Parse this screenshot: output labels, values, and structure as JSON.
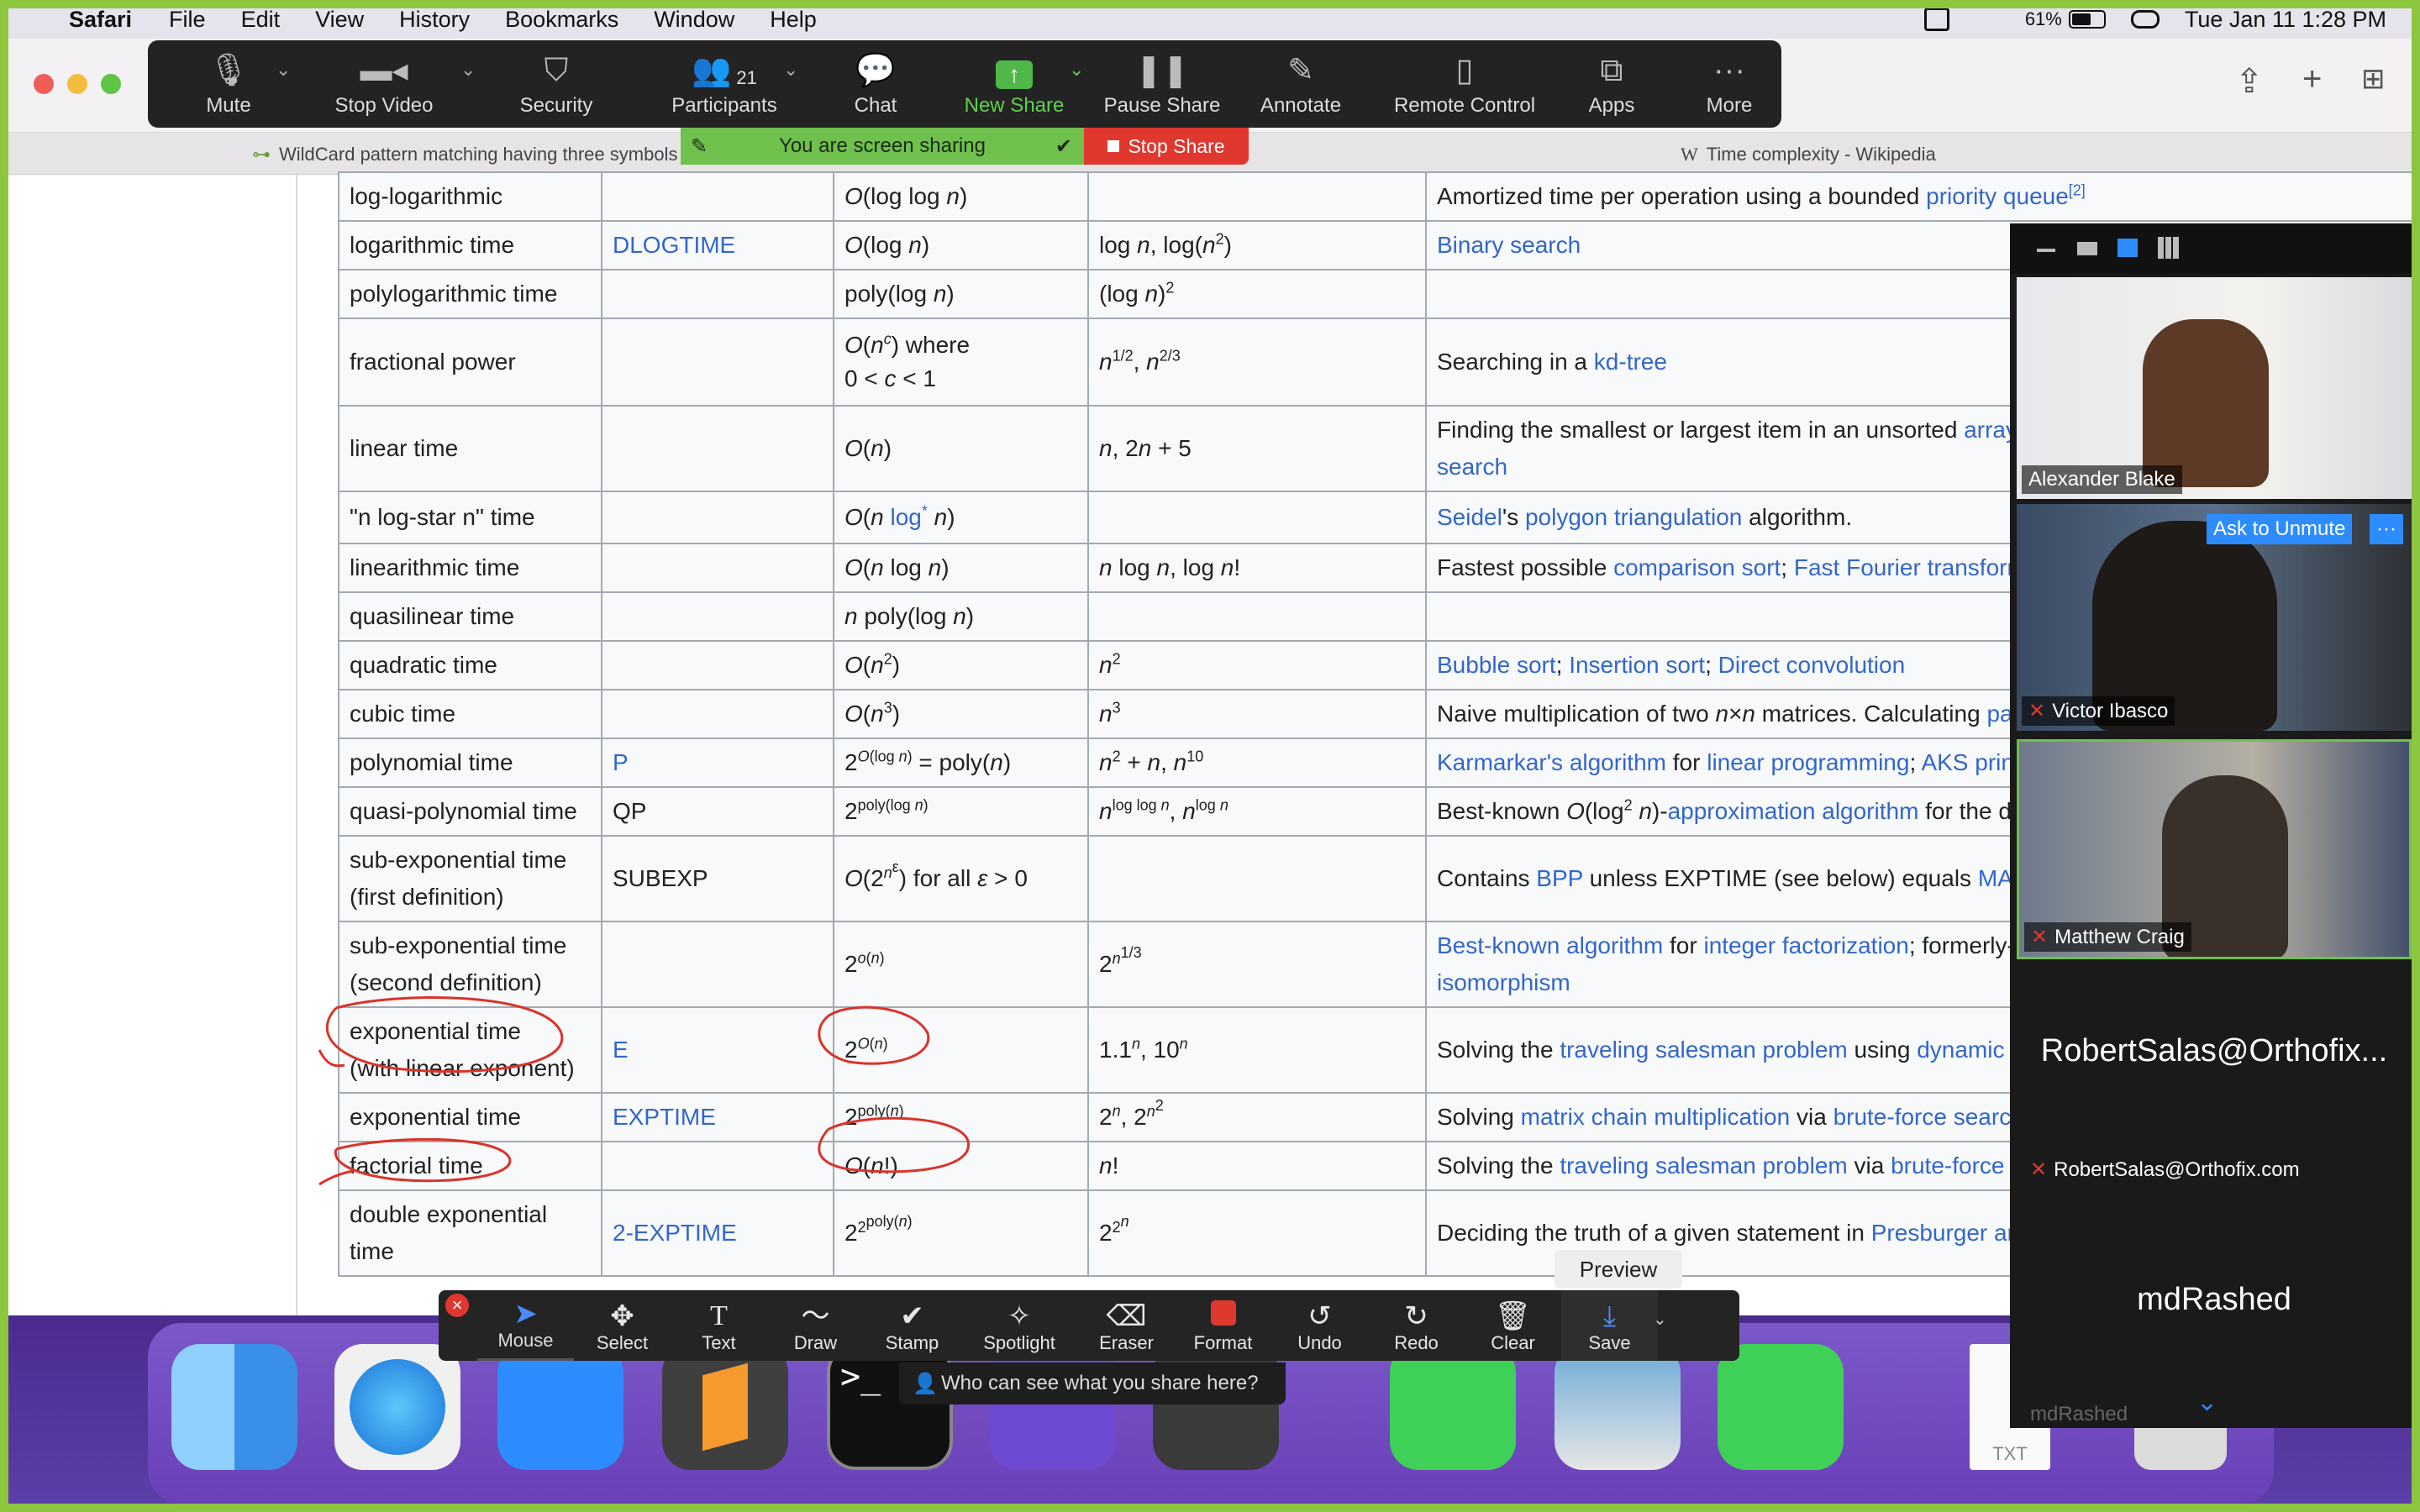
{
  "menubar": {
    "app": "Safari",
    "items": [
      "File",
      "Edit",
      "View",
      "History",
      "Bookmarks",
      "Window",
      "Help"
    ],
    "battery": "61%",
    "datetime": "Tue Jan 11  1:28 PM"
  },
  "tabs": {
    "left": "WildCard pattern matching having three symbols",
    "right": "Time complexity - Wikipedia"
  },
  "zoom_toolbar": [
    {
      "label": "Mute",
      "icon": "microphone-icon"
    },
    {
      "label": "Stop Video",
      "icon": "video-camera-icon"
    },
    {
      "label": "Security",
      "icon": "shield-icon"
    },
    {
      "label": "Participants",
      "icon": "people-icon",
      "count": "21"
    },
    {
      "label": "Chat",
      "icon": "chat-bubble-icon"
    },
    {
      "label": "New Share",
      "icon": "share-arrow-icon"
    },
    {
      "label": "Pause Share",
      "icon": "pause-icon"
    },
    {
      "label": "Annotate",
      "icon": "pencil-icon"
    },
    {
      "label": "Remote Control",
      "icon": "mouse-icon"
    },
    {
      "label": "Apps",
      "icon": "apps-icon"
    },
    {
      "label": "More",
      "icon": "more-dots-icon"
    }
  ],
  "share_banner": {
    "text": "You are screen sharing",
    "stop": "Stop Share"
  },
  "table": {
    "rows": [
      [
        "log-logarithmic",
        "",
        "O(log log n)",
        "",
        "Amortized time per operation using a bounded priority queue[2]"
      ],
      [
        "logarithmic time",
        "DLOGTIME",
        "O(log n)",
        "log n, log(n2)",
        "Binary search"
      ],
      [
        "polylogarithmic time",
        "",
        "poly(log n)",
        "(log n)2",
        ""
      ],
      [
        "fractional power",
        "",
        "O(nc) where 0 < c < 1",
        "n1/2, n2/3",
        "Searching in a kd-tree"
      ],
      [
        "linear time",
        "",
        "O(n)",
        "n, 2n + 5",
        "Finding the smallest or largest item in an unsorted array search"
      ],
      [
        "\"n log-star n\" time",
        "",
        "O(n log* n)",
        "",
        "Seidel's polygon triangulation algorithm."
      ],
      [
        "linearithmic time",
        "",
        "O(n log n)",
        "n log n, log n!",
        "Fastest possible comparison sort; Fast Fourier transform"
      ],
      [
        "quasilinear time",
        "",
        "n poly(log n)",
        "",
        ""
      ],
      [
        "quadratic time",
        "",
        "O(n2)",
        "n2",
        "Bubble sort; Insertion sort; Direct convolution"
      ],
      [
        "cubic time",
        "",
        "O(n3)",
        "n3",
        "Naive multiplication of two n×n matrices. Calculating pa"
      ],
      [
        "polynomial time",
        "P",
        "2O(log n) = poly(n)",
        "n2 + n, n10",
        "Karmarkar's algorithm for linear programming; AKS prin"
      ],
      [
        "quasi-polynomial time",
        "QP",
        "2poly(log n)",
        "nlog log n, nlog n",
        "Best-known O(log2 n)-approximation algorithm for the d"
      ],
      [
        "sub-exponential time (first definition)",
        "SUBEXP",
        "O(2nε) for all ε > 0",
        "",
        "Contains BPP unless EXPTIME (see below) equals MA"
      ],
      [
        "sub-exponential time (second definition)",
        "",
        "2o(n)",
        "2n1/3",
        "Best-known algorithm for integer factorization; formerly-isomorphism"
      ],
      [
        "exponential time (with linear exponent)",
        "E",
        "2O(n)",
        "1.1n, 10n",
        "Solving the traveling salesman problem using dynamic"
      ],
      [
        "exponential time",
        "EXPTIME",
        "2poly(n)",
        "2n, 2n2",
        "Solving matrix chain multiplication via brute-force searc"
      ],
      [
        "factorial time",
        "",
        "O(n!)",
        "n!",
        "Solving the traveling salesman problem via brute-force"
      ],
      [
        "double exponential time",
        "2-EXPTIME",
        "22poly(n)",
        "22n",
        "Deciding the truth of a given statement in Presburger ar"
      ]
    ]
  },
  "participants": {
    "tiles": [
      {
        "name": "Alexander Blake"
      },
      {
        "name": "Victor Ibasco",
        "action": "Ask to Unmute",
        "more": "···"
      },
      {
        "name": "Matthew Craig"
      }
    ],
    "name_only": [
      {
        "big": "RobertSalas@Orthofix...",
        "small": "RobertSalas@Orthofix.com"
      },
      {
        "big": "mdRashed",
        "small": "mdRashed"
      }
    ]
  },
  "annotate_toolbar": [
    {
      "label": "Mouse",
      "icon": "cursor-arrow-icon"
    },
    {
      "label": "Select",
      "icon": "move-arrows-icon"
    },
    {
      "label": "Text",
      "icon": "text-T-icon"
    },
    {
      "label": "Draw",
      "icon": "squiggle-icon"
    },
    {
      "label": "Stamp",
      "icon": "checkmark-icon"
    },
    {
      "label": "Spotlight",
      "icon": "magic-wand-icon"
    },
    {
      "label": "Eraser",
      "icon": "eraser-icon"
    },
    {
      "label": "Format",
      "icon": "color-square-icon"
    },
    {
      "label": "Undo",
      "icon": "undo-icon"
    },
    {
      "label": "Redo",
      "icon": "redo-icon"
    },
    {
      "label": "Clear",
      "icon": "trash-icon"
    },
    {
      "label": "Save",
      "icon": "save-icon"
    }
  ],
  "annotate_extras": {
    "who_can_see": "Who can see what you share here?",
    "preview": "Preview"
  },
  "dock": {
    "file_label": "TXT"
  },
  "colors": {
    "share_green": "#8cc63f",
    "wiki_link": "#3366cc",
    "annotation_red": "#d9342b",
    "stop_red": "#e0382e"
  }
}
